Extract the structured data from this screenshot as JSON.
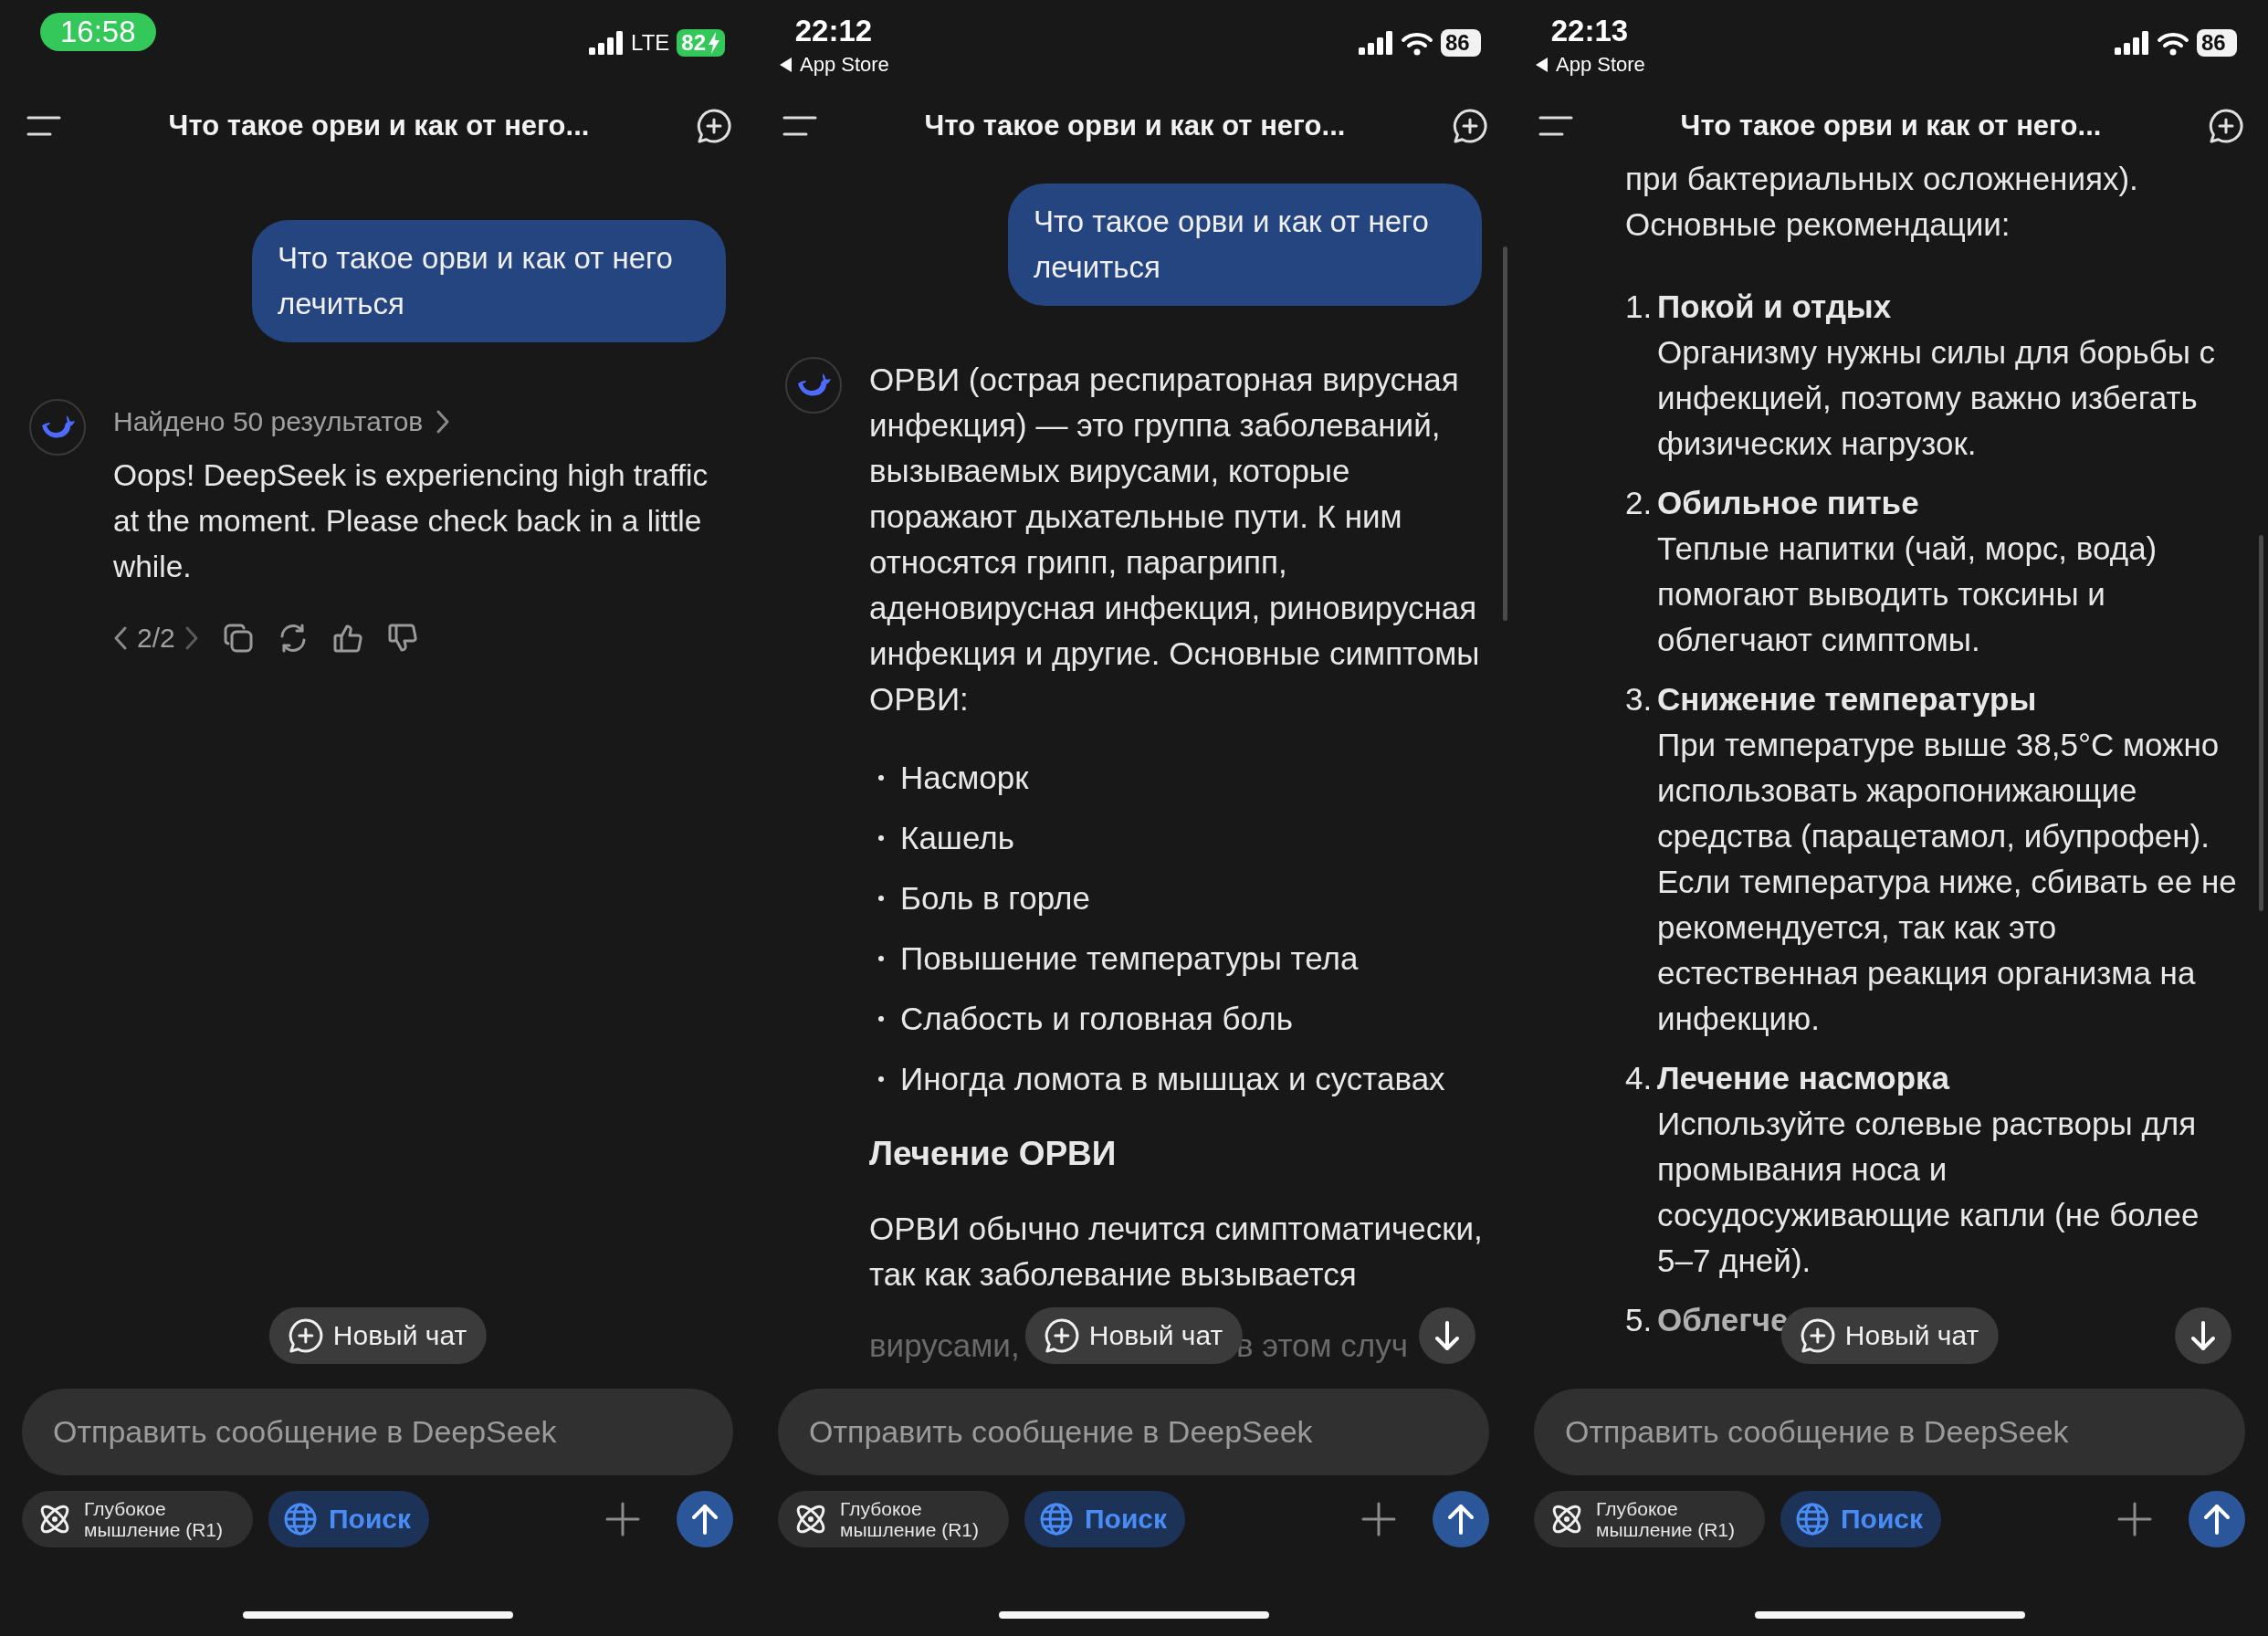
{
  "panels": [
    {
      "status_bar": {
        "time": "16:58",
        "time_pill": true,
        "network": {
          "kind": "cellular_text",
          "label": "LTE"
        },
        "battery": "82",
        "charging": true
      },
      "header": {
        "title": "Что такое орви и как от него..."
      },
      "user_message": "Что такое орви и как от него лечиться",
      "assistant": {
        "avatar": true,
        "search_summary": "Найдено 50 результатов",
        "blocks": [
          {
            "kind": "paragraph",
            "text": "Oops! DeepSeek is experiencing high traffic at the moment. Please check back in a little while."
          }
        ],
        "actions": {
          "pager": "2/2"
        }
      },
      "new_chat": "Новый чат",
      "composer": {
        "placeholder": "Отправить сообщение в DeepSeek",
        "toggles": [
          {
            "kind": "atom",
            "label": "Глубокое мышление (R1)",
            "selected": false
          },
          {
            "kind": "globe",
            "label": "Поиск",
            "selected": true
          }
        ]
      }
    },
    {
      "status_bar": {
        "time": "22:12",
        "time_pill": false,
        "back_link": "App Store",
        "network": {
          "kind": "wifi"
        },
        "battery": "86",
        "charging": false
      },
      "header": {
        "title": "Что такое орви и как от него..."
      },
      "user_message": "Что такое орви и как от него лечиться",
      "assistant": {
        "avatar": true,
        "blocks": [
          {
            "kind": "paragraph",
            "text": "ОРВИ (острая респираторная вирусная инфекция) — это группа заболеваний, вызываемых вирусами, которые поражают дыхательные пути. К ним относятся грипп, парагрипп, аденовирусная инфекция, риновирусная инфекция и другие. Основные симптомы ОРВИ:"
          },
          {
            "kind": "bullets",
            "items": [
              "Насморк",
              "Кашель",
              "Боль в горле",
              "Повышение температуры тела",
              "Слабость и головная боль",
              "Иногда ломота в мышцах и суставах"
            ]
          },
          {
            "kind": "heading",
            "text": "Лечение ОРВИ"
          },
          {
            "kind": "paragraph",
            "text": "ОРВИ обычно лечится симптоматически, так как заболевание вызывается"
          },
          {
            "kind": "faded_line",
            "parts": [
              "вирусами,",
              "в этом случ"
            ]
          }
        ]
      },
      "new_chat": "Новый чат",
      "scroll_down": true,
      "composer": {
        "placeholder": "Отправить сообщение в DeepSeek",
        "toggles": [
          {
            "kind": "atom",
            "label": "Глубокое мышление (R1)",
            "selected": false
          },
          {
            "kind": "globe",
            "label": "Поиск",
            "selected": true
          }
        ]
      }
    },
    {
      "status_bar": {
        "time": "22:13",
        "time_pill": false,
        "back_link": "App Store",
        "network": {
          "kind": "wifi"
        },
        "battery": "86",
        "charging": false
      },
      "header": {
        "title": "Что такое орви и как от него..."
      },
      "assistant": {
        "blocks": [
          {
            "kind": "paragraph",
            "text": "при бактериальных осложнениях). Основные рекомендации:"
          },
          {
            "kind": "numbered",
            "items": [
              {
                "number": "1.",
                "title": "Покой и отдых",
                "text": "Организму нужны силы для борьбы с инфекцией, поэтому важно избегать физических нагрузок."
              },
              {
                "number": "2.",
                "title": "Обильное питье",
                "text": "Теплые напитки (чай, морс, вода) помогают выводить токсины и облегчают симптомы."
              },
              {
                "number": "3.",
                "title": "Снижение температуры",
                "text": "При температуре выше 38,5°C можно использовать жаропонижающие средства (парацетамол, ибупрофен). Если температура ниже, сбивать ее не рекомендуется, так как это естественная реакция организма на инфекцию."
              },
              {
                "number": "4.",
                "title": "Лечение насморка",
                "text": "Используйте солевые растворы для промывания носа и сосудосуживающие капли (не более 5–7 дней)."
              }
            ]
          },
          {
            "kind": "faded_item",
            "number": "5.",
            "title": "Облегче"
          }
        ]
      },
      "new_chat": "Новый чат",
      "scroll_down": true,
      "composer": {
        "placeholder": "Отправить сообщение в DeepSeek",
        "toggles": [
          {
            "kind": "atom",
            "label": "Глубокое мышление (R1)",
            "selected": false
          },
          {
            "kind": "globe",
            "label": "Поиск",
            "selected": true
          }
        ]
      }
    }
  ]
}
